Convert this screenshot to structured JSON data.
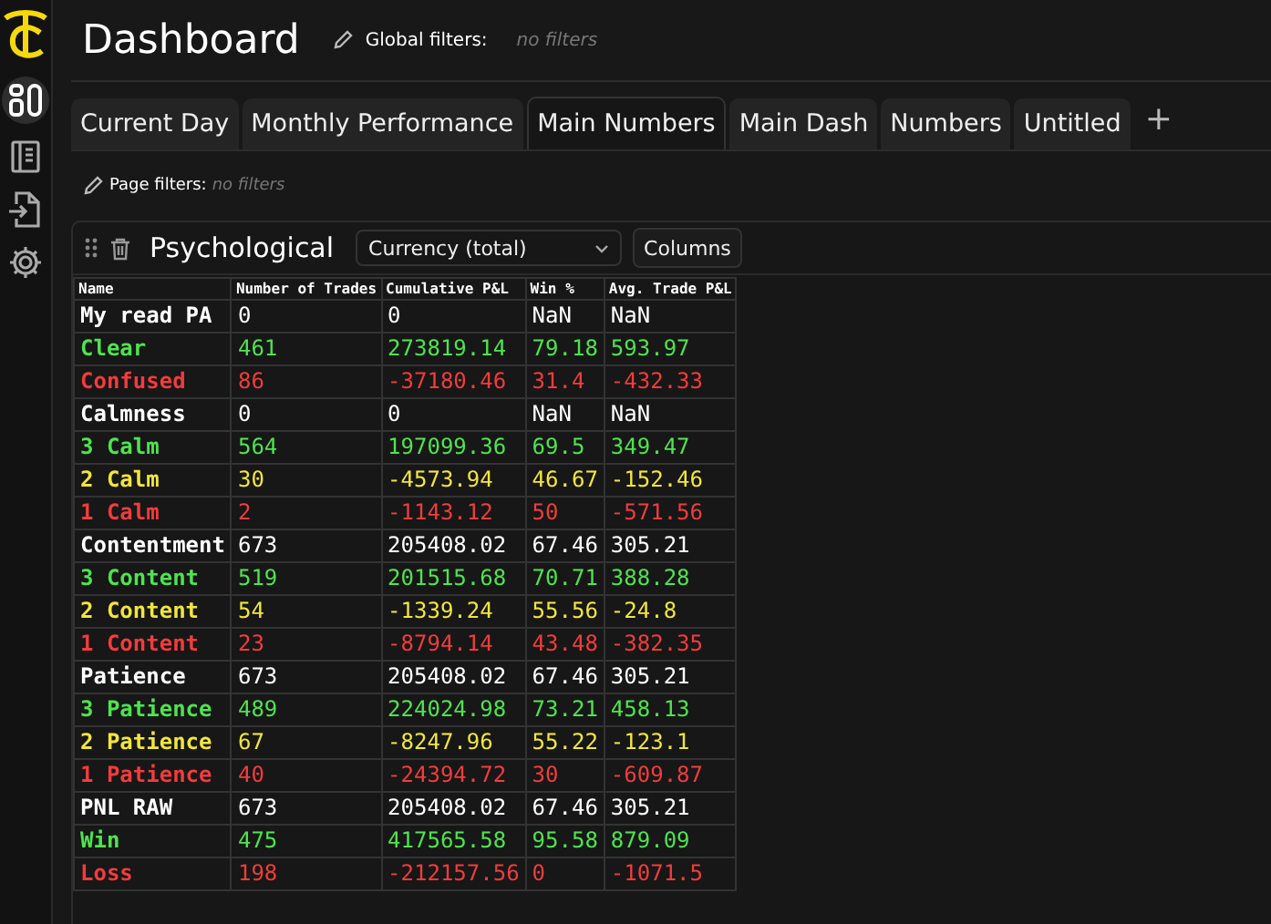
{
  "header": {
    "title": "Dashboard",
    "global_filters_label": "Global filters:",
    "global_filters_value": "no filters"
  },
  "tabs": [
    {
      "label": "Current Day",
      "selected": false
    },
    {
      "label": "Monthly Performance",
      "selected": false
    },
    {
      "label": "Main Numbers",
      "selected": true
    },
    {
      "label": "Main Dash",
      "selected": false
    },
    {
      "label": "Numbers",
      "selected": false
    },
    {
      "label": "Untitled",
      "selected": false
    }
  ],
  "add_tab": "+",
  "page_filters": {
    "label": "Page filters:",
    "value": "no filters"
  },
  "widget": {
    "title": "Psychological",
    "dropdown": "Currency (total)",
    "columns_button": "Columns",
    "table": {
      "columns": [
        "Name",
        "Number of Trades",
        "Cumulative P&L",
        "Win %",
        "Avg. Trade P&L"
      ],
      "rows": [
        {
          "cells": [
            "My read PA",
            "0",
            "0",
            "NaN",
            "NaN"
          ],
          "color": "#ffffff"
        },
        {
          "cells": [
            "Clear",
            "461",
            "273819.14",
            "79.18",
            "593.97"
          ],
          "color": "#4ee44e"
        },
        {
          "cells": [
            "Confused",
            "86",
            "-37180.46",
            "31.4",
            "-432.33"
          ],
          "color": "#f23c3c"
        },
        {
          "cells": [
            "Calmness",
            "0",
            "0",
            "NaN",
            "NaN"
          ],
          "color": "#ffffff"
        },
        {
          "cells": [
            "3 Calm",
            "564",
            "197099.36",
            "69.5",
            "349.47"
          ],
          "color": "#4ee44e"
        },
        {
          "cells": [
            "2 Calm",
            "30",
            "-4573.94",
            "46.67",
            "-152.46"
          ],
          "color": "#f2e63c"
        },
        {
          "cells": [
            "1 Calm",
            "2",
            "-1143.12",
            "50",
            "-571.56"
          ],
          "color": "#f23c3c"
        },
        {
          "cells": [
            "Contentment",
            "673",
            "205408.02",
            "67.46",
            "305.21"
          ],
          "color": "#ffffff"
        },
        {
          "cells": [
            "3 Content",
            "519",
            "201515.68",
            "70.71",
            "388.28"
          ],
          "color": "#4ee44e"
        },
        {
          "cells": [
            "2 Content",
            "54",
            "-1339.24",
            "55.56",
            "-24.8"
          ],
          "color": "#f2e63c"
        },
        {
          "cells": [
            "1 Content",
            "23",
            "-8794.14",
            "43.48",
            "-382.35"
          ],
          "color": "#f23c3c"
        },
        {
          "cells": [
            "Patience",
            "673",
            "205408.02",
            "67.46",
            "305.21"
          ],
          "color": "#ffffff"
        },
        {
          "cells": [
            "3 Patience",
            "489",
            "224024.98",
            "73.21",
            "458.13"
          ],
          "color": "#4ee44e"
        },
        {
          "cells": [
            "2 Patience",
            "67",
            "-8247.96",
            "55.22",
            "-123.1"
          ],
          "color": "#f2e63c"
        },
        {
          "cells": [
            "1 Patience",
            "40",
            "-24394.72",
            "30",
            "-609.87"
          ],
          "color": "#f23c3c"
        },
        {
          "cells": [
            "PNL RAW",
            "673",
            "205408.02",
            "67.46",
            "305.21"
          ],
          "color": "#ffffff"
        },
        {
          "cells": [
            "Win",
            "475",
            "417565.58",
            "95.58",
            "879.09"
          ],
          "color": "#4ee44e"
        },
        {
          "cells": [
            "Loss",
            "198",
            "-212157.56",
            "0",
            "-1071.5"
          ],
          "color": "#f23c3c"
        }
      ]
    }
  }
}
